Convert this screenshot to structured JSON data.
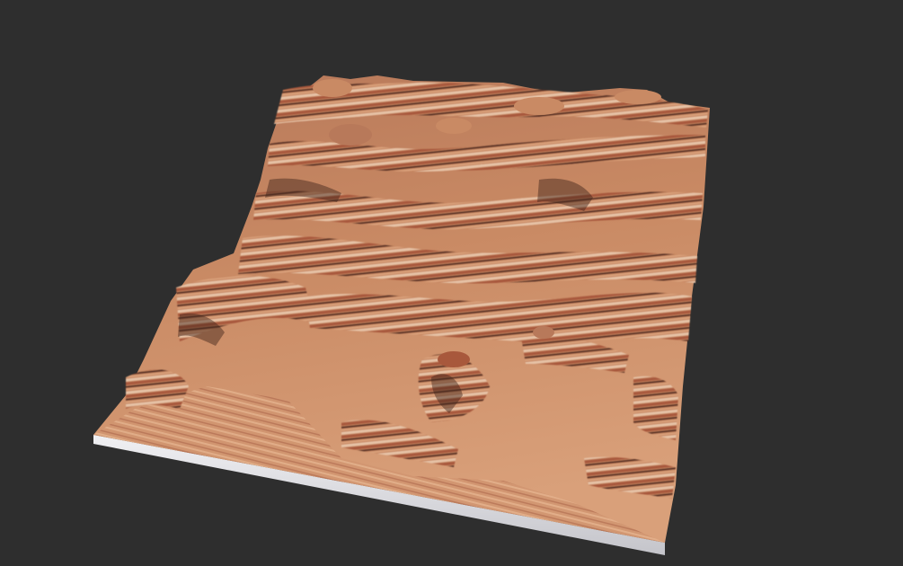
{
  "viewport": {
    "background_color": "#2e2e2e"
  },
  "terrain": {
    "material": {
      "sand_light": "#d9a07a",
      "sand_mid": "#c4825d",
      "rust_band": "#a8583c",
      "dark_band": "#5a3325",
      "pale_band": "#e6c2a6",
      "shadow": "#3b2219"
    },
    "base_slab_color": "#e8e8ec",
    "base_slab_shadow": "#b9b9c0"
  }
}
